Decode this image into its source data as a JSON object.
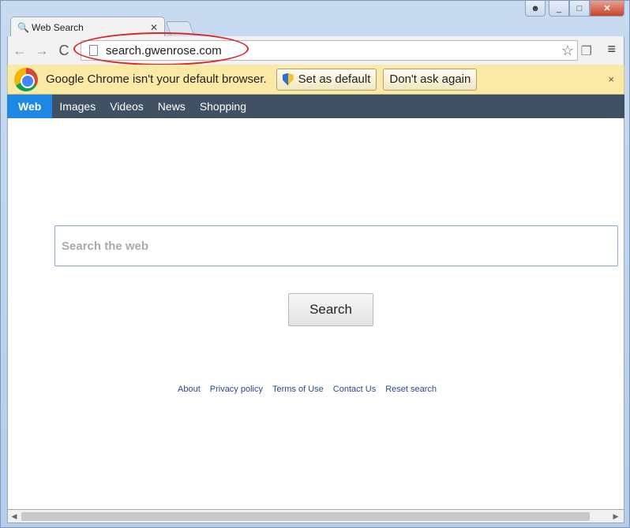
{
  "window": {
    "controls": {
      "user_icon": "user-icon",
      "minimize": "_",
      "maximize": "□",
      "close": "✕"
    }
  },
  "tab": {
    "title": "Web Search",
    "icon": "search-icon",
    "close": "✕"
  },
  "toolbar": {
    "back": "←",
    "forward": "→",
    "reload": "C",
    "url": "search.gwenrose.com",
    "star": "☆",
    "menu": "≡",
    "extension": "❐"
  },
  "infobar": {
    "message": "Google Chrome isn't your default browser.",
    "set_default_label": "Set as default",
    "dont_ask_label": "Don't ask again",
    "close": "×"
  },
  "search_nav": {
    "items": [
      {
        "label": "Web",
        "active": true
      },
      {
        "label": "Images"
      },
      {
        "label": "Videos"
      },
      {
        "label": "News"
      },
      {
        "label": "Shopping"
      }
    ]
  },
  "search": {
    "placeholder": "Search the web",
    "button_label": "Search"
  },
  "footer": {
    "links": [
      "About",
      "Privacy policy",
      "Terms of Use",
      "Contact Us",
      "Reset search"
    ]
  },
  "colors": {
    "nav_bg": "#3f5163",
    "nav_active": "#1e88e5",
    "infobar_bg": "#fbe9a6",
    "highlight_oval": "#d9262a"
  }
}
